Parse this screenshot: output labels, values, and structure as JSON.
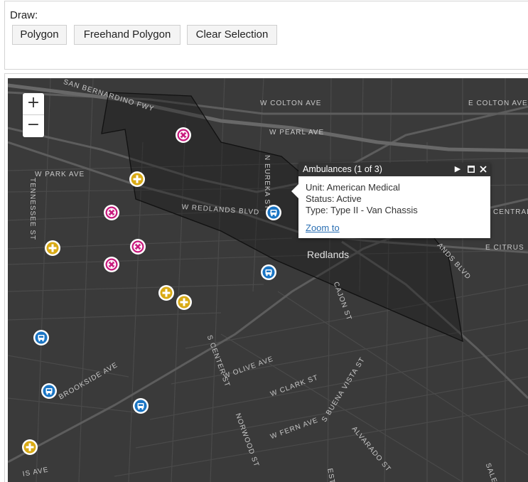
{
  "draw": {
    "label": "Draw:",
    "buttons": [
      "Polygon",
      "Freehand Polygon",
      "Clear Selection"
    ]
  },
  "zoom": {
    "in_label": "+",
    "out_label": "−"
  },
  "map": {
    "city_label": "Redlands",
    "streets": [
      "SAN BERNARDINO FWY",
      "W COLTON AVE",
      "W PEARL AVE",
      "E COLTON AVE",
      "W PARK AVE",
      "TENNESSEE ST",
      "N EUREKA ST",
      "W REDLANDS BLVD",
      "CENTRAL A",
      "E CITRUS",
      "ANDS BLVD",
      "CAJON ST",
      "BROOKSIDE AVE",
      "S CENTER ST",
      "W OLIVE AVE",
      "W CLARK ST",
      "NORWOOD ST",
      "W FERN AVE",
      "S BUENA VISTA ST",
      "ALVARADO ST",
      "SALEM",
      "IS AVE",
      "EST"
    ],
    "colors": {
      "ambulance": "#1a75c4",
      "hospital": "#c8197d",
      "fire": "#d9aa14",
      "base": "#3a3a3a"
    },
    "layers": [
      "ambulance",
      "hospital",
      "fire-station"
    ]
  },
  "popup": {
    "title": "Ambulances (1 of 3)",
    "unit": "Unit: American Medical",
    "status": "Status: Active",
    "type": "Type: Type II - Van Chassis",
    "zoom_link": "Zoom to",
    "icons": [
      "next-icon",
      "maximize-icon",
      "close-icon"
    ]
  }
}
